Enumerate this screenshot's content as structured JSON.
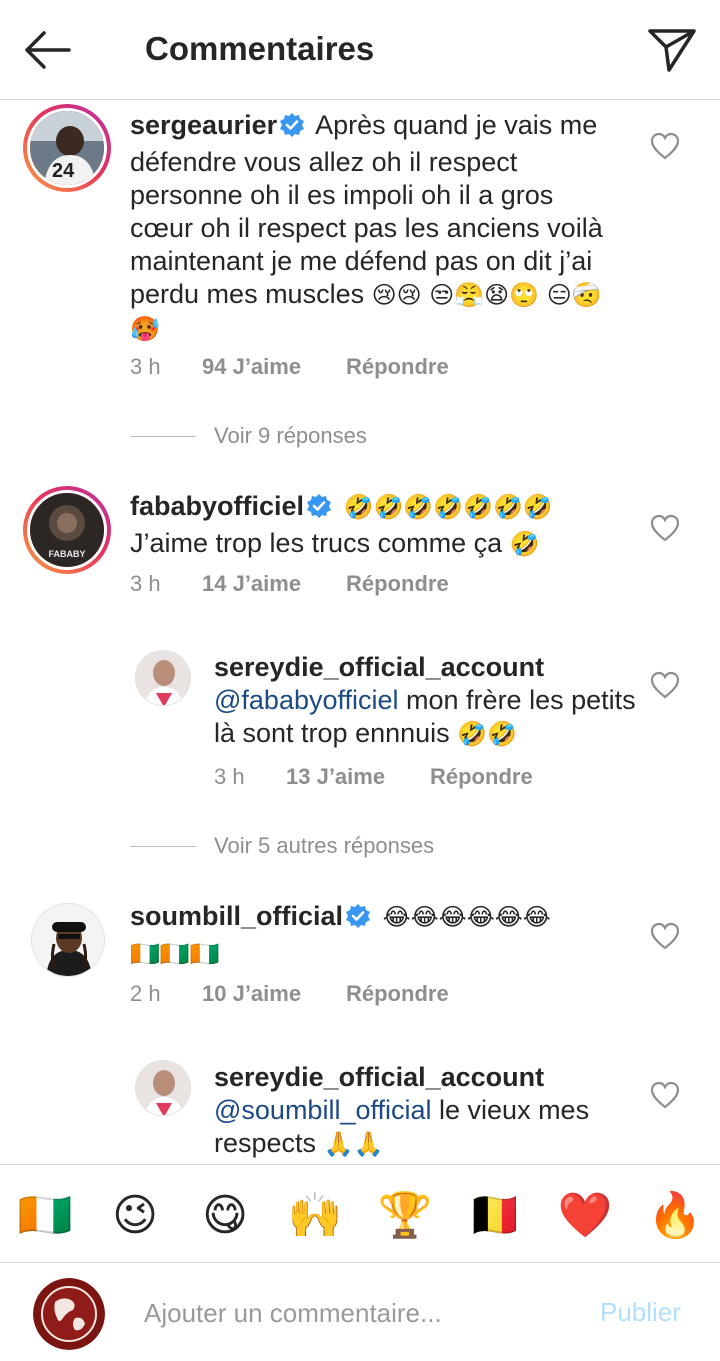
{
  "header": {
    "title": "Commentaires"
  },
  "comments": [
    {
      "username": "sergeaurier",
      "text": "Après quand je vais me défendre vous allez oh il respect personne oh il es impoli oh il a gros cœur oh il respect pas les anciens  voilà maintenant je me défend pas on dit j’ai perdu mes muscles",
      "emojis": "😢😢 😒😤😧🙄 😑🤕🥵",
      "time": "3 h",
      "likes": "94 J’aime",
      "reply": "Répondre",
      "view_replies": "Voir 9 réponses"
    },
    {
      "username": "fababyofficiel",
      "emojis_inline": "🤣🤣🤣🤣🤣🤣🤣",
      "text": "J’aime trop les trucs comme ça",
      "emojis": "🤣",
      "time": "3 h",
      "likes": "14 J’aime",
      "reply": "Répondre"
    },
    {
      "username": "sereydie_official_account",
      "mention": "@fababyofficiel",
      "text": " mon frère les petits là sont trop ennnuis",
      "emojis": "🤣🤣",
      "time": "3 h",
      "likes": "13 J’aime",
      "reply": "Répondre",
      "view_replies": "Voir 5 autres réponses"
    },
    {
      "username": "soumbill_official",
      "emojis_inline": "😂😂😂😂😂😂",
      "emojis": "🇨🇮🇨🇮🇨🇮",
      "time": "2 h",
      "likes": "10 J’aime",
      "reply": "Répondre"
    },
    {
      "username": "sereydie_official_account",
      "mention": "@soumbill_official",
      "text": " le vieux mes respects",
      "emojis": "🙏🙏"
    }
  ],
  "emoji_bar": [
    "🇨🇮",
    "😉",
    "😋",
    "🙌",
    "🏆",
    "🇧🇪",
    "❤️",
    "🔥"
  ],
  "input": {
    "placeholder": "Ajouter un commentaire...",
    "publish": "Publier"
  },
  "colors": {
    "mention": "#1b4a85",
    "verified": "#3897f0",
    "publish_disabled": "#b2dffc",
    "meta": "#8e8e8e"
  }
}
